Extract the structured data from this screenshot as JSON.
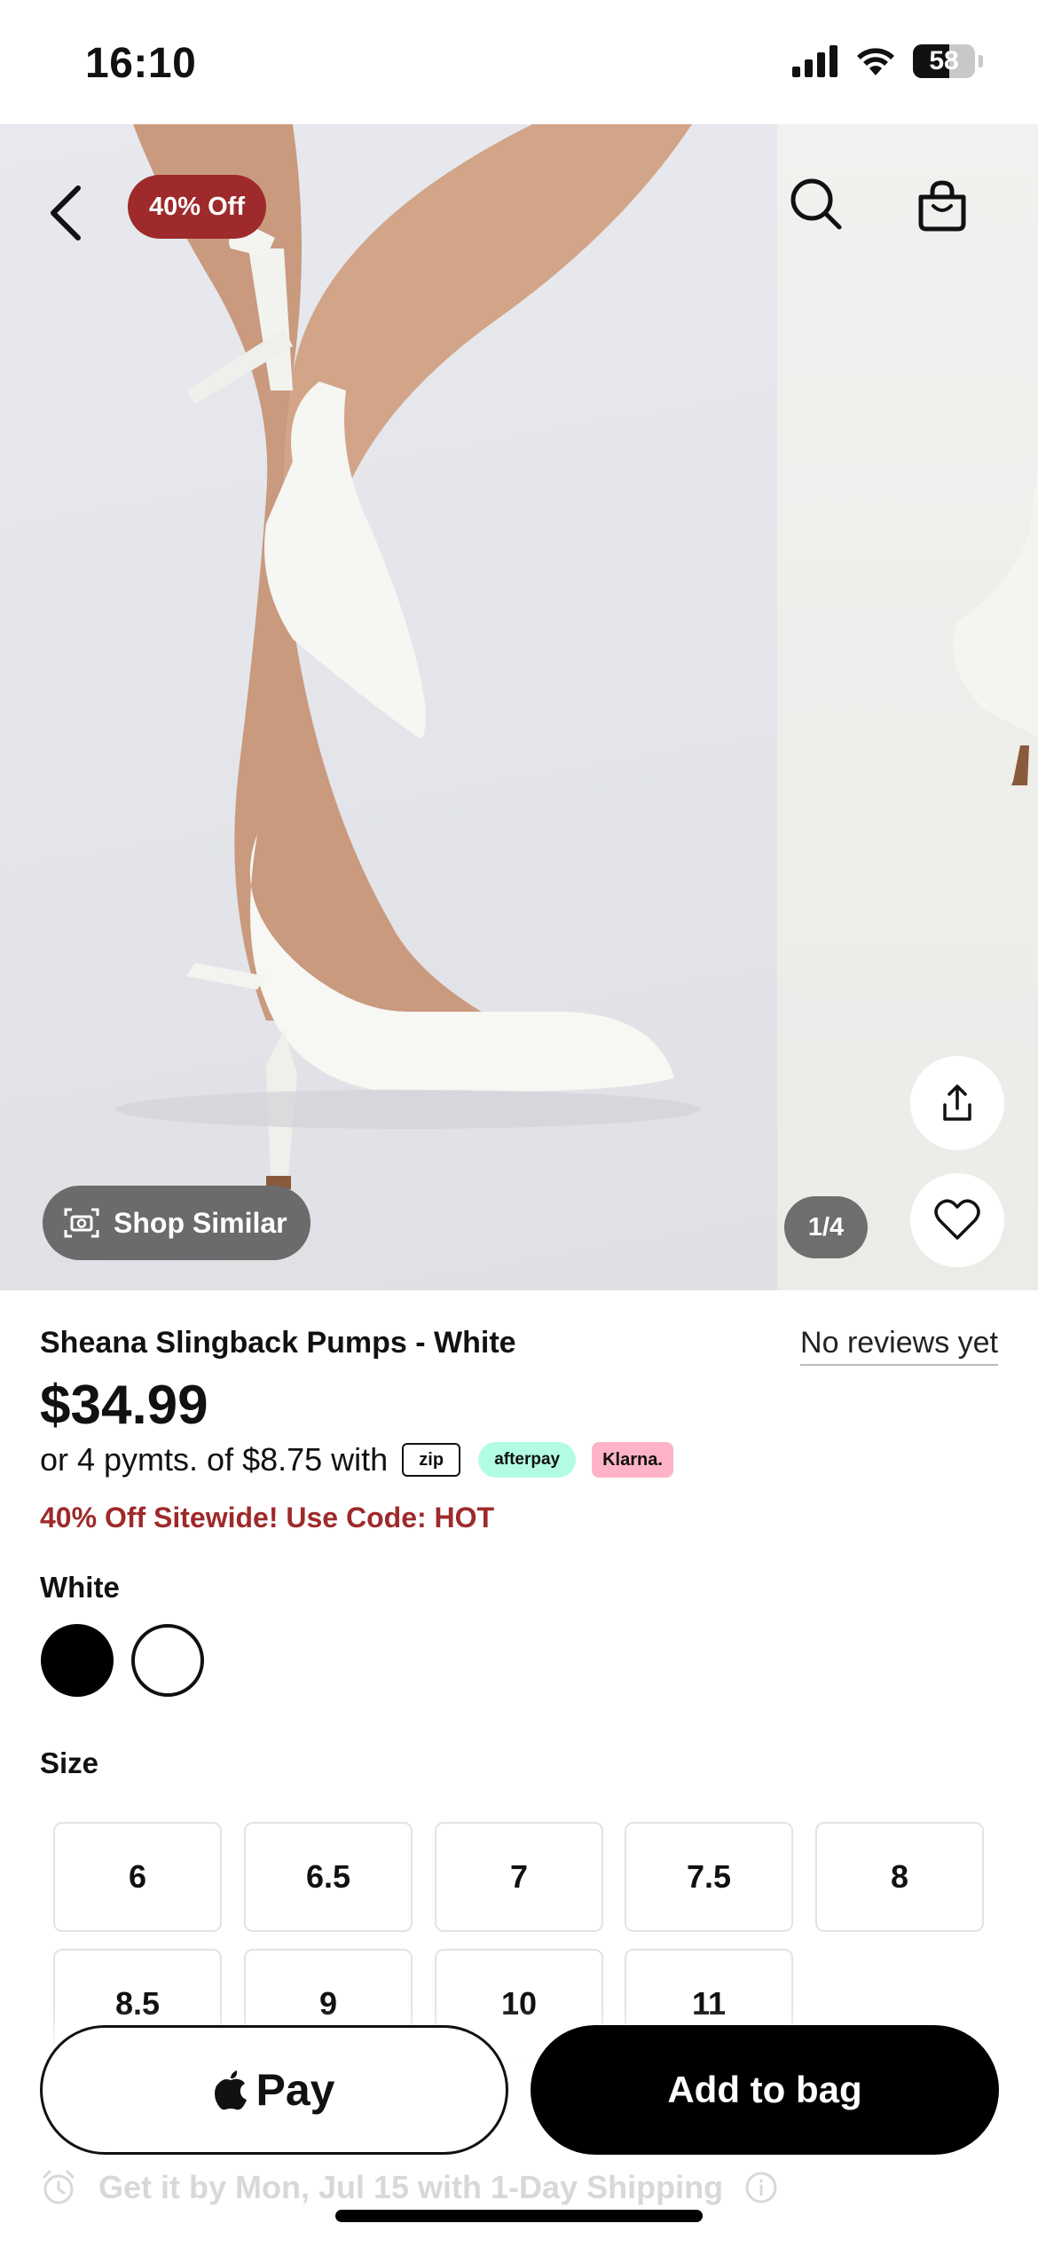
{
  "status_bar": {
    "time": "16:10",
    "battery": "58",
    "battery_level": 0.58
  },
  "gallery": {
    "discount_badge": "40% Off",
    "page_counter": "1/4",
    "shop_similar_label": "Shop Similar"
  },
  "product": {
    "name": "Sheana Slingback Pumps - White",
    "reviews": "No reviews yet",
    "price": "$34.99",
    "installments_text": "or 4 pymts. of $8.75 with",
    "payment_providers": [
      "zip",
      "afterpay",
      "Klarna."
    ],
    "promo": "40% Off Sitewide! Use Code: HOT"
  },
  "color": {
    "selected_label": "White",
    "swatches": [
      {
        "name": "Black",
        "hex": "#000000"
      },
      {
        "name": "White",
        "hex": "#ffffff"
      }
    ]
  },
  "size": {
    "label": "Size",
    "options": [
      "6",
      "6.5",
      "7",
      "7.5",
      "8",
      "8.5",
      "9",
      "10",
      "11"
    ]
  },
  "actions": {
    "apple_pay_label": "Pay",
    "add_to_bag_label": "Add to bag",
    "shipping_text": "Get it by Mon, Jul 15 with 1-Day Shipping"
  },
  "colors": {
    "accent_red": "#9e2a2b",
    "afterpay_mint": "#b2fce4",
    "klarna_pink": "#ffb3c7"
  }
}
